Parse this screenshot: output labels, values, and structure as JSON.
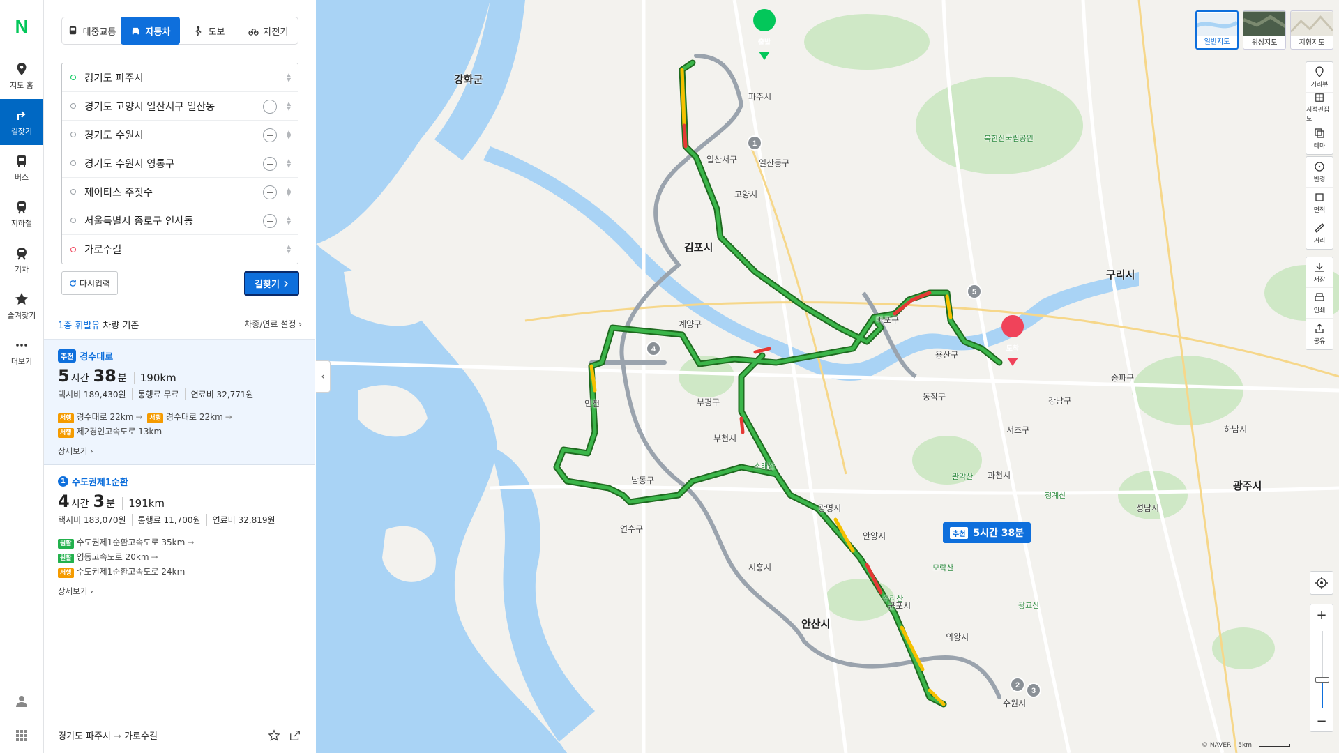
{
  "brand": "N",
  "nav": [
    {
      "label": "지도 홈",
      "icon": "map-pin-icon"
    },
    {
      "label": "길찾기",
      "icon": "directions-icon",
      "active": true
    },
    {
      "label": "버스",
      "icon": "bus-icon"
    },
    {
      "label": "지하철",
      "icon": "subway-icon"
    },
    {
      "label": "기차",
      "icon": "train-icon"
    },
    {
      "label": "즐겨찾기",
      "icon": "star-icon"
    },
    {
      "label": "더보기",
      "icon": "more-icon"
    }
  ],
  "modes": [
    "대중교통",
    "자동차",
    "도보",
    "자전거"
  ],
  "active_mode": "자동차",
  "waypoints": [
    "경기도 파주시",
    "경기도 고양시 일산서구 일산동",
    "경기도 수원시",
    "경기도 수원시 영통구",
    "제이티스 주짓수",
    "서울특별시 종로구 인사동",
    "가로수길"
  ],
  "buttons": {
    "reset": "다시입력",
    "search": "길찾기"
  },
  "fuel": {
    "type": "1종 휘발유",
    "suffix": "차량 기준",
    "settings": "차종/연료 설정"
  },
  "routes": [
    {
      "badge": "추천",
      "name": "경수대로",
      "hours": "5",
      "hour_unit": "시간",
      "minutes": "38",
      "minute_unit": "분",
      "distance": "190km",
      "taxi": "택시비 189,430원",
      "toll": "통행료 무료",
      "fuel_cost": "연료비 32,771원",
      "segments": [
        {
          "tag": "서행",
          "text": "경수대로 22km"
        },
        {
          "tag": "서행",
          "text": "경수대로 22km"
        },
        {
          "tag": "서행",
          "text": "제2경인고속도로 13km"
        }
      ],
      "detail": "상세보기"
    },
    {
      "badge": "1",
      "name": "수도권제1순환",
      "hours": "4",
      "hour_unit": "시간",
      "minutes": "3",
      "minute_unit": "분",
      "distance": "191km",
      "taxi": "택시비 183,070원",
      "toll": "통행료 11,700원",
      "fuel_cost": "연료비 32,819원",
      "segments": [
        {
          "tag": "원활",
          "text": "수도권제1순환고속도로 35km"
        },
        {
          "tag": "원활",
          "text": "영동고속도로 20km"
        },
        {
          "tag": "서행",
          "text": "수도권제1순환고속도로 24km"
        }
      ],
      "detail": "상세보기"
    }
  ],
  "footer": {
    "from": "경기도 파주시",
    "to": "가로수길"
  },
  "map": {
    "layers": [
      "일반지도",
      "위성지도",
      "지형지도"
    ],
    "tools": [
      {
        "label": "거리뷰",
        "icon": "street-view-icon"
      },
      {
        "label": "지적편집도",
        "icon": "cadastral-icon"
      },
      {
        "label": "테마",
        "icon": "theme-icon"
      },
      {
        "label": "반경",
        "icon": "radius-icon"
      },
      {
        "label": "면적",
        "icon": "area-icon"
      },
      {
        "label": "거리",
        "icon": "ruler-icon"
      },
      {
        "label": "저장",
        "icon": "download-icon"
      },
      {
        "label": "인쇄",
        "icon": "print-icon"
      },
      {
        "label": "공유",
        "icon": "share-icon"
      }
    ],
    "start_marker": "출발",
    "end_marker": "도착",
    "bubble": {
      "badge": "추천",
      "text": "5시간 38분"
    },
    "waypoint_numbers": [
      "1",
      "2",
      "3",
      "4",
      "5"
    ],
    "copyright": "© NAVER",
    "scale": "5km",
    "labels": {
      "cities": [
        "강화군",
        "김포시",
        "구리시",
        "안산시",
        "광주시"
      ],
      "places": [
        "일산서구",
        "일산동구",
        "마포구",
        "용산구",
        "동작구",
        "서초구",
        "강남구",
        "송파구",
        "남동구",
        "연수구",
        "부평구",
        "계양구",
        "시흥시",
        "광명시",
        "안양시",
        "군포시",
        "의왕시",
        "수원시",
        "과천시",
        "성남시",
        "하남시",
        "고양시",
        "파주시",
        "부천시",
        "인천"
      ],
      "parks": [
        "북한산국립공원",
        "청계산",
        "관악산",
        "소래산",
        "모락산",
        "수리산",
        "광교산"
      ]
    }
  }
}
